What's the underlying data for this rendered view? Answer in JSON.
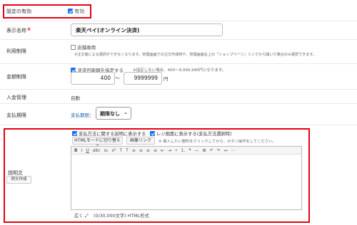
{
  "enabled": {
    "label": "設定の有効",
    "checkbox_label": "有効"
  },
  "display_name": {
    "label": "表示名称",
    "value": "楽天ペイ(オンライン決済)"
  },
  "usage_limit": {
    "label": "利用制限",
    "checkbox_label": "店舗専用",
    "note": "※注文者による選択ができなくなります。管理画面での注文作成時や、管理画面右上の「ショップページ」リンクから開いた場合のみ選択できます。"
  },
  "amount_limit": {
    "label": "金額制限",
    "checkbox_label": "決済可能額を指定する",
    "note": "※指定しない場合、400〜9,999,999円となります。",
    "min": "400",
    "tilde": "〜",
    "max": "9999999",
    "unit": "円"
  },
  "deposit": {
    "label": "入金管理",
    "value": "自動"
  },
  "payment_deadline": {
    "label": "支払期限",
    "link": "支払期限",
    "colon": "：",
    "select_value": "期限なし"
  },
  "description": {
    "label": "説明文",
    "example_button": "例文作成",
    "show_explanation": "支払方法に関する説明に表示する",
    "show_register": "レジ画面に表示する(支払方法選択時)",
    "html_mode_button": "HTMLモードに切り替える",
    "image_link_button": "画像リンク",
    "hint": "※ 挿入したい箇所をクリックしてから、ボタン操作をしてください。",
    "expand": "広く",
    "char_count": "(0/30,000文字) HTML形式",
    "toolbar_icons": [
      "B",
      "I",
      "U",
      "abc",
      "x₂",
      "x²",
      "T",
      "T",
      "≡",
      "≡",
      "≡",
      "≡",
      "⇤",
      "⇥",
      "•",
      "1.",
      "❝",
      "—",
      "⊞",
      "↶",
      "↷",
      "↔",
      "⋯"
    ]
  },
  "colors": {
    "highlight": "#e60012",
    "accent": "#1a73e8",
    "link": "#1a5fb4"
  }
}
